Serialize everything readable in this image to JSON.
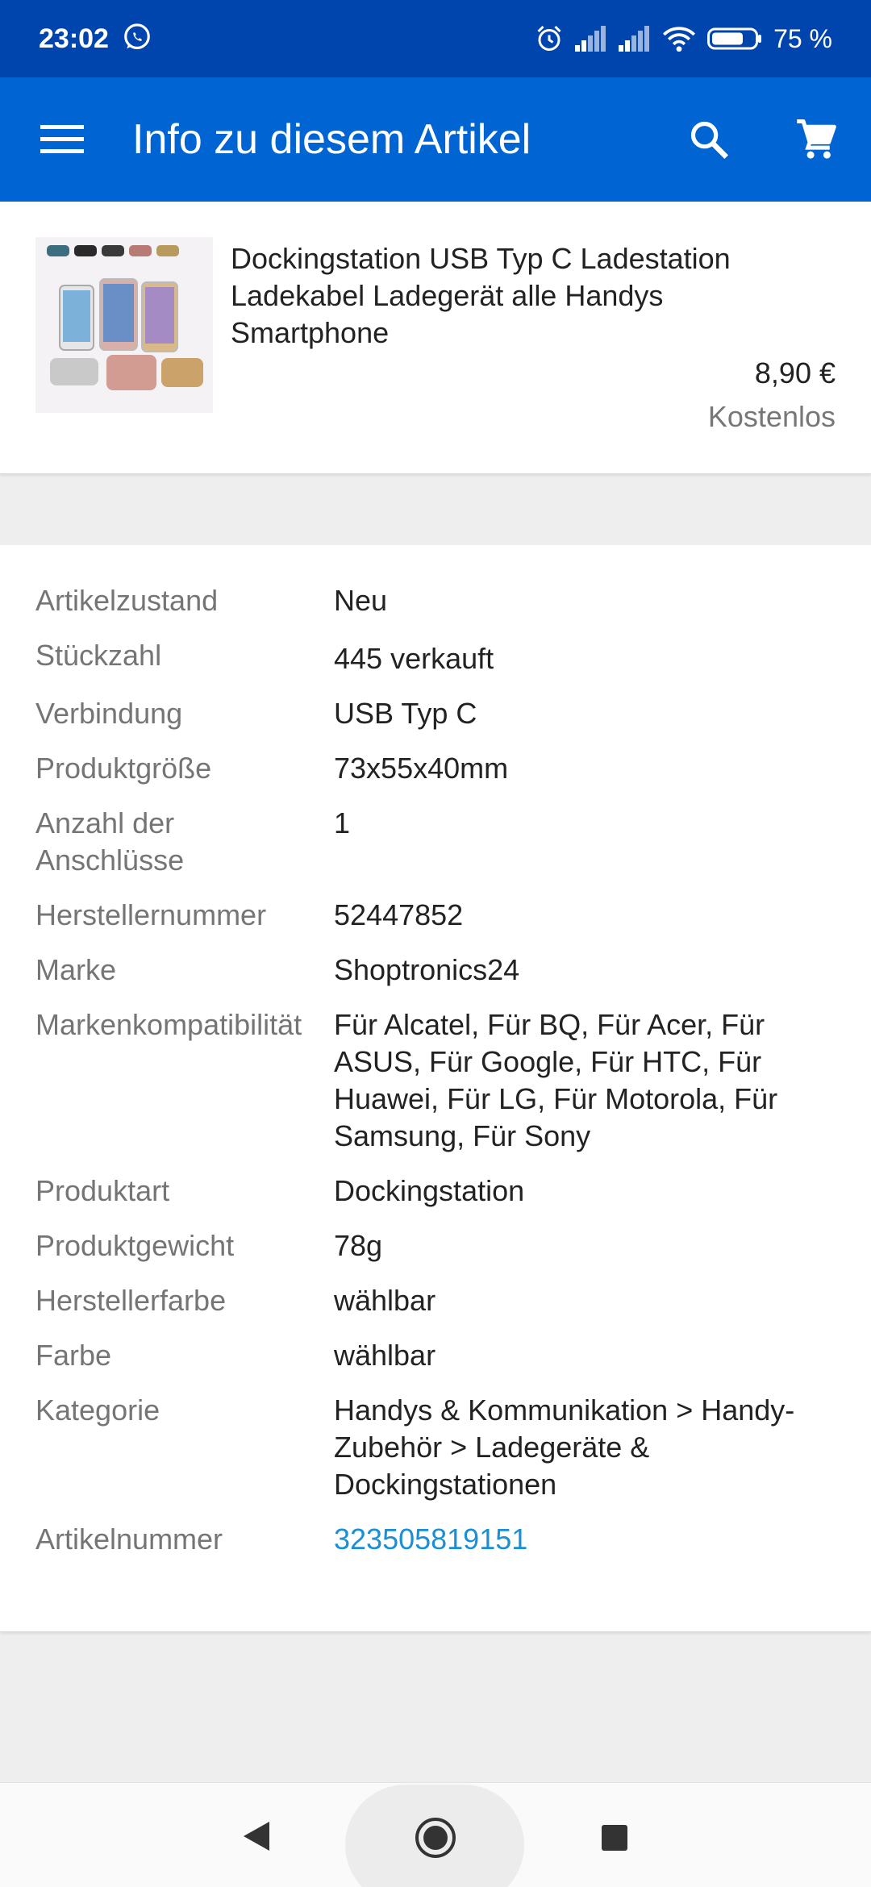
{
  "status_bar": {
    "time": "23:02",
    "battery_percent": "75 %",
    "battery_level": 0.75,
    "icons": [
      "whatsapp-icon",
      "alarm-icon",
      "signal-icon",
      "signal-icon",
      "wifi-icon",
      "battery-icon"
    ]
  },
  "app_bar": {
    "title": "Info zu diesem Artikel",
    "icons": [
      "menu-icon",
      "search-icon",
      "cart-icon"
    ]
  },
  "product": {
    "title": "Dockingstation USB Typ C Ladestation Ladekabel Ladegerät alle Handys Smartphone",
    "price": "8,90 €",
    "shipping": "Kostenlos"
  },
  "specs": [
    {
      "label": "Artikelzustand",
      "value": "Neu"
    },
    {
      "label": "Stückzahl",
      "value": "445 verkauft"
    },
    {
      "label": "Verbindung",
      "value": "USB Typ C"
    },
    {
      "label": "Produktgröße",
      "value": "73x55x40mm"
    },
    {
      "label": "Anzahl der Anschlüsse",
      "value": "1"
    },
    {
      "label": "Herstellernummer",
      "value": "52447852"
    },
    {
      "label": "Marke",
      "value": "Shoptronics24"
    },
    {
      "label": "Markenkompatibilität",
      "value": "Für Alcatel, Für BQ, Für Acer, Für ASUS, Für Google, Für HTC, Für Huawei, Für LG, Für Motorola, Für Samsung, Für Sony"
    },
    {
      "label": "Produktart",
      "value": "Dockingstation"
    },
    {
      "label": "Produktgewicht",
      "value": "78g"
    },
    {
      "label": "Herstellerfarbe",
      "value": "wählbar"
    },
    {
      "label": "Farbe",
      "value": "wählbar"
    },
    {
      "label": "Kategorie",
      "value": "Handys & Kommunikation > Handy-Zubehör > Ladegeräte & Dockingstationen"
    },
    {
      "label": "Artikelnummer",
      "value": "323505819151"
    }
  ],
  "colors": {
    "status_bar": "#0045ad",
    "app_bar": "#0064d2",
    "link": "#1a8fd6",
    "label": "#757575",
    "background": "#eeeeee"
  },
  "nav_bar": {
    "icons": [
      "back-icon",
      "home-icon",
      "recents-icon"
    ]
  }
}
